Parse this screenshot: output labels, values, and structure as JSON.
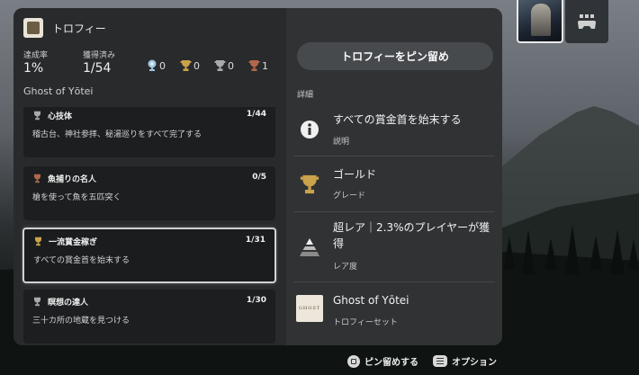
{
  "header": {
    "title": "トロフィー"
  },
  "stats": {
    "achievement_label": "達成率",
    "achievement_value": "1%",
    "earned_label": "獲得済み",
    "earned_value": "1/54",
    "platinum": "0",
    "gold": "0",
    "silver": "0",
    "bronze": "1"
  },
  "game_name": "Ghost of Yōtei",
  "trophies": [
    {
      "name": "心技体",
      "count": "1/44",
      "desc": "稽古台、神社参拝、秘湯巡りをすべて完了する",
      "grade": "silver"
    },
    {
      "name": "魚捕りの名人",
      "count": "0/5",
      "desc": "槍を使って魚を五匹突く",
      "grade": "bronze"
    },
    {
      "name": "一流賞金稼ぎ",
      "count": "1/31",
      "desc": "すべての賞金首を始末する",
      "grade": "gold"
    },
    {
      "name": "瞑想の達人",
      "count": "1/30",
      "desc": "三十カ所の地蔵を見つける",
      "grade": "silver"
    }
  ],
  "detail": {
    "pin_label": "トロフィーをピン留め",
    "section_label": "詳細",
    "description_value": "すべての賞金首を始末する",
    "description_label": "説明",
    "grade_value": "ゴールド",
    "grade_label": "グレード",
    "rarity_value": "超レア｜2.3%のプレイヤーが獲得",
    "rarity_label": "レア度",
    "set_value": "Ghost of Yōtei",
    "set_label": "トロフィーセット",
    "set_thumb_text": "GHOST"
  },
  "footer": {
    "pin_action": "ピン留めする",
    "options_action": "オプション"
  },
  "colors": {
    "gold": "#c9a24a",
    "silver": "#a7a9ac",
    "bronze": "#b0674a",
    "platinum": "#9fc3dc"
  }
}
